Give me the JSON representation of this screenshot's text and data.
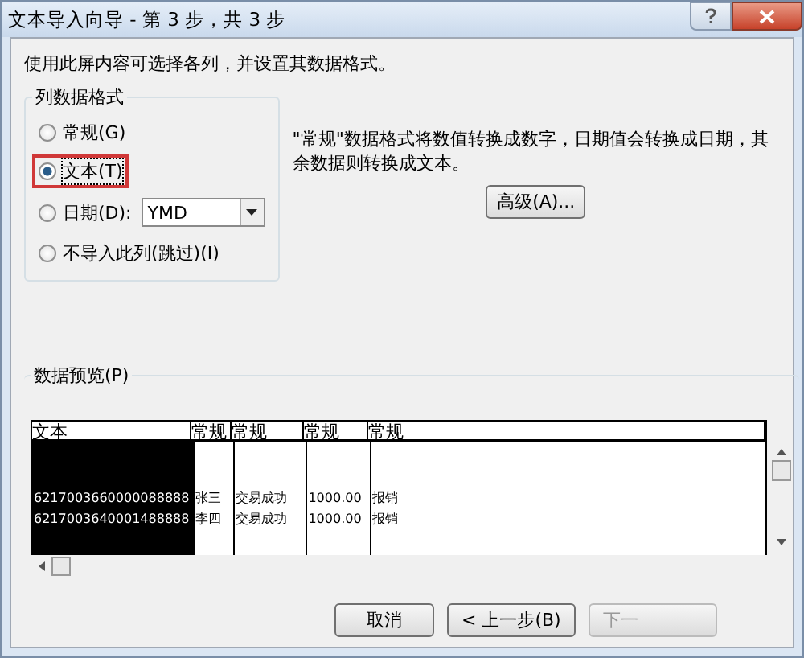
{
  "window": {
    "title": "文本导入向导 - 第 3 步，共 3 步"
  },
  "instruction": "使用此屏内容可选择各列，并设置其数据格式。",
  "format_group": {
    "title": "列数据格式",
    "options": [
      {
        "kind": "radio",
        "label": "常规(G)",
        "selected": false,
        "highlighted": false
      },
      {
        "kind": "radio",
        "label": "文本(T)",
        "selected": true,
        "highlighted": true
      },
      {
        "kind": "date",
        "label": "日期(D):",
        "selected": false,
        "highlighted": false,
        "value": "YMD"
      },
      {
        "kind": "radio",
        "label": "不导入此列(跳过)(I)",
        "selected": false,
        "highlighted": false
      }
    ]
  },
  "description": "\"常规\"数据格式将数值转换成数字，日期值会转换成日期，其余数据则转换成文本。",
  "advanced_button": "高级(A)...",
  "preview": {
    "label": "数据预览(P)",
    "columns": [
      {
        "header": "文本",
        "selected": true
      },
      {
        "header": "常规",
        "selected": false
      },
      {
        "header": "常规",
        "selected": false
      },
      {
        "header": "常规",
        "selected": false
      },
      {
        "header": "常规",
        "selected": false
      }
    ],
    "rows": [
      [
        "6217003660000088888",
        "张三",
        "交易成功",
        "1000.00",
        "报销"
      ],
      [
        "6217003640001488888",
        "李四",
        "交易成功",
        "1000.00",
        "报销"
      ]
    ]
  },
  "buttons": [
    {
      "label": "取消",
      "disabled": false
    },
    {
      "label": "< 上一步(B)",
      "disabled": false
    },
    {
      "label": "下一",
      "disabled": true
    }
  ]
}
